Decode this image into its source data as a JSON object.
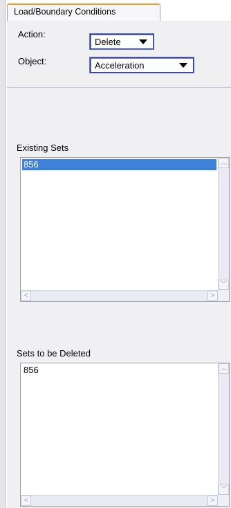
{
  "tab": {
    "label": "Load/Boundary Conditions"
  },
  "form": {
    "action_label": "Action:",
    "action_value": "Delete",
    "object_label": "Object:",
    "object_value": "Acceleration"
  },
  "existing_sets": {
    "title": "Existing Sets",
    "items": [
      "856"
    ],
    "selected_index": 0
  },
  "delete_sets": {
    "title": "Sets to be Deleted",
    "items": [
      "856"
    ]
  },
  "scroll_glyphs": {
    "up": "︿",
    "down": "﹀",
    "left": "<",
    "right": ">"
  },
  "colors": {
    "tab_accent": "#f0a030",
    "selection": "#3f80d8",
    "combo_border": "#2a3d8f"
  }
}
